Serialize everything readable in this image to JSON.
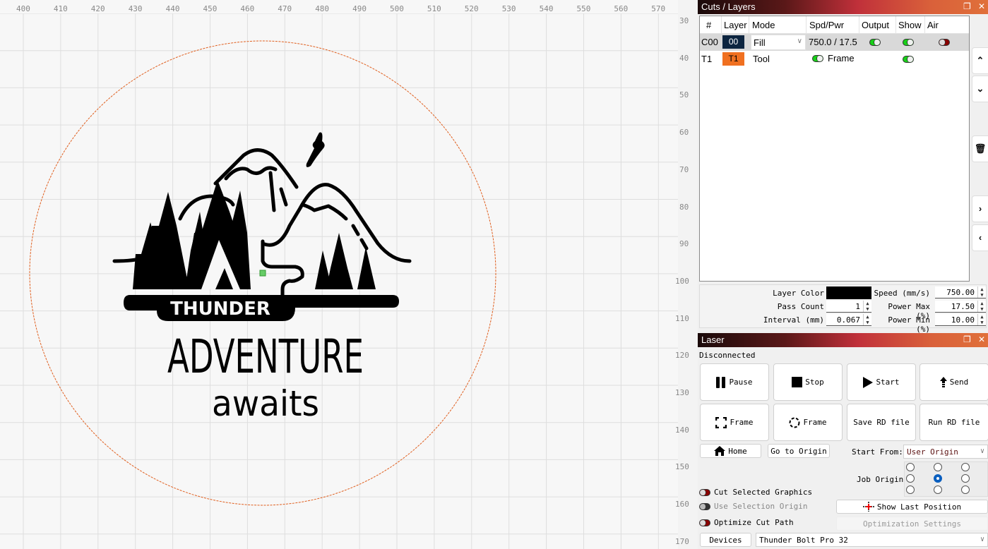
{
  "canvas": {
    "ruler_x": [
      "400",
      "410",
      "420",
      "430",
      "440",
      "450",
      "460",
      "470",
      "480",
      "490",
      "500",
      "510",
      "520",
      "530",
      "540",
      "550",
      "560",
      "570"
    ],
    "ruler_y": [
      "30",
      "40",
      "50",
      "60",
      "70",
      "80",
      "90",
      "100",
      "110",
      "120",
      "130",
      "140",
      "150",
      "160",
      "170"
    ],
    "design": {
      "banner_text": "THUNDER",
      "headline": "ADVENTURE",
      "subline": "awaits"
    },
    "colors": {
      "cut_circle": "#e06020",
      "grid": "#dcdcdc",
      "selection_handle": "#66cc66"
    }
  },
  "cuts_panel": {
    "title": "Cuts / Layers",
    "float_icon": "float-icon",
    "close_icon": "close-icon",
    "columns": [
      "#",
      "Layer",
      "Mode",
      "Spd/Pwr",
      "Output",
      "Show",
      "Air"
    ],
    "rows": [
      {
        "num": "C00",
        "layer": "00",
        "layer_color": "#0d2540",
        "mode": "Fill",
        "spd_pwr": "750.0 / 17.5",
        "output": true,
        "show": true,
        "air": false,
        "selected": true
      },
      {
        "num": "T1",
        "layer": "T1",
        "layer_color": "#f07020",
        "mode": "Tool",
        "spd_pwr": "Frame",
        "frame_toggle": true,
        "show": true,
        "selected": false
      }
    ],
    "side_buttons": [
      "move-up",
      "move-down",
      "delete",
      "expand-right",
      "collapse-left"
    ],
    "properties": {
      "layer_color_label": "Layer Color",
      "layer_color": "#000000",
      "pass_count_label": "Pass Count",
      "pass_count": "1",
      "interval_label": "Interval (mm)",
      "interval": "0.067",
      "speed_label": "Speed (mm/s)",
      "speed": "750.00",
      "power_max_label": "Power Max (%)",
      "power_max": "17.50",
      "power_min_label": "Power Min (%)",
      "power_min": "10.00"
    }
  },
  "laser_panel": {
    "title": "Laser",
    "status": "Disconnected",
    "buttons_row1": [
      "Pause",
      "Stop",
      "Start",
      "Send"
    ],
    "buttons_row2": [
      "Frame",
      "Frame",
      "Save RD file",
      "Run RD file"
    ],
    "home_label": "Home",
    "go_origin_label": "Go to Origin",
    "start_from_label": "Start From:",
    "start_from_value": "User Origin",
    "job_origin_label": "Job Origin",
    "job_origin_selected": "middle-center",
    "cut_selected_label": "Cut Selected Graphics",
    "cut_selected": false,
    "use_selection_origin_label": "Use Selection Origin",
    "use_selection_origin": false,
    "optimize_cut_label": "Optimize Cut Path",
    "optimize_cut": false,
    "show_last_position_label": "Show Last Position",
    "optimization_settings_label": "Optimization Settings",
    "devices_label": "Devices",
    "device_value": "Thunder Bolt Pro 32"
  }
}
